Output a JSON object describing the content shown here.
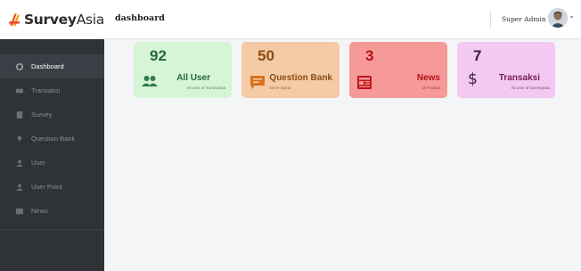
{
  "brand": {
    "name_bold": "Survey",
    "name_light": "Asia"
  },
  "sidebar": {
    "items": [
      {
        "label": "Dashboard",
        "icon": "dashboard-icon"
      },
      {
        "label": "Transaksi",
        "icon": "card-icon"
      },
      {
        "label": "Survey",
        "icon": "survey-icon"
      },
      {
        "label": "Question Bank",
        "icon": "pin-icon"
      },
      {
        "label": "User",
        "icon": "user-icon"
      },
      {
        "label": "User Point",
        "icon": "user-icon"
      },
      {
        "label": "News",
        "icon": "news-icon"
      }
    ]
  },
  "header": {
    "title": "dashboard",
    "user_name": "Super Admin",
    "caret": "▾"
  },
  "cards": [
    {
      "value": "92",
      "label": "All User",
      "sub": "All user of Surveyasia",
      "icon": "users-icon"
    },
    {
      "value": "50",
      "label": "Question Bank",
      "sub": "Since Stand",
      "icon": "chat-icon"
    },
    {
      "value": "3",
      "label": "News",
      "sub": "of Product",
      "icon": "newspaper-icon"
    },
    {
      "value": "7",
      "label": "Transaksi",
      "sub": "All user of Surveyasia",
      "icon": "dollar-icon"
    }
  ],
  "colors": {
    "sidebar_bg": "#2f3237",
    "card_all_user": "#d6f5d6",
    "card_question_bank": "#f5cba5",
    "card_news": "#f59a98",
    "card_transaksi": "#f3c9f2",
    "brand_accent": "#f05a1a"
  }
}
